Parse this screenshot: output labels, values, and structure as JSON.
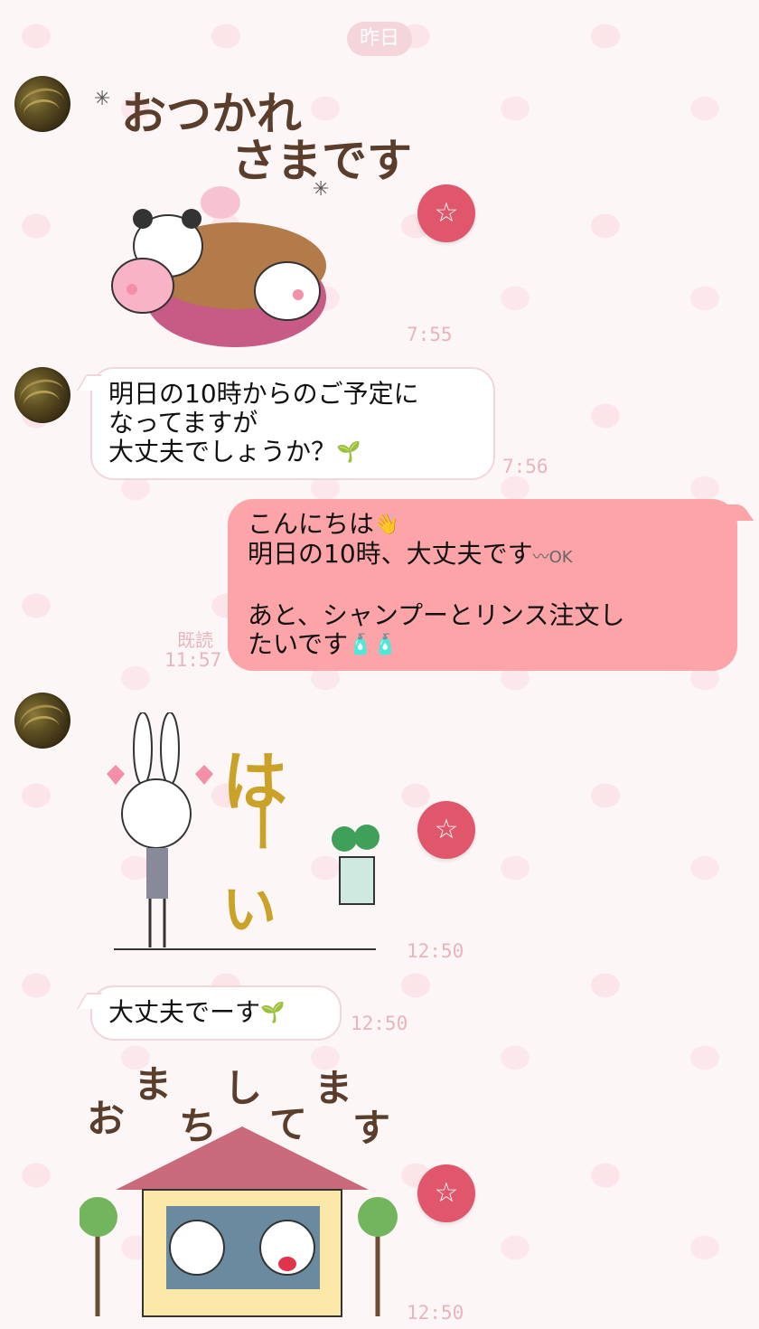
{
  "date_separator": "昨日",
  "messages": [
    {
      "id": "m1",
      "side": "in",
      "type": "sticker",
      "sticker_text": [
        "おつかれ",
        "さまです"
      ],
      "time": "7:55"
    },
    {
      "id": "m2",
      "side": "in",
      "type": "text",
      "lines": [
        "明日の10時からのご予定に",
        "なってますが",
        "大丈夫でしょうか？"
      ],
      "time": "7:56"
    },
    {
      "id": "m3",
      "side": "out",
      "type": "text",
      "lines": [
        "こんにちは",
        "明日の10時、大丈夫です",
        "",
        "あと、シャンプーとリンス注文し",
        "たいです"
      ],
      "read_label": "既読",
      "time": "11:57"
    },
    {
      "id": "m4",
      "side": "in",
      "type": "sticker",
      "sticker_text": [
        "は",
        "ー",
        "い"
      ],
      "time": "12:50"
    },
    {
      "id": "m5",
      "side": "in",
      "type": "text",
      "lines": [
        "大丈夫でーす"
      ],
      "time": "12:50"
    },
    {
      "id": "m6",
      "side": "in",
      "type": "sticker",
      "sticker_text": [
        "お",
        "ま",
        "ち",
        "し",
        "て",
        "ま",
        "す"
      ],
      "time": "12:50"
    }
  ],
  "icons": {
    "favorite": "star-icon",
    "avatar": "avatar",
    "sprout": "sprout-icon",
    "waving_hand": "waving-hand-icon",
    "ok_badge": "ok-icon",
    "bottle": "bottle-icon"
  },
  "ok_label": "OK",
  "colors": {
    "outgoing_bubble": "#fca4a8",
    "favorite_button": "#e0566a",
    "timestamp": "#e7b6bb"
  }
}
